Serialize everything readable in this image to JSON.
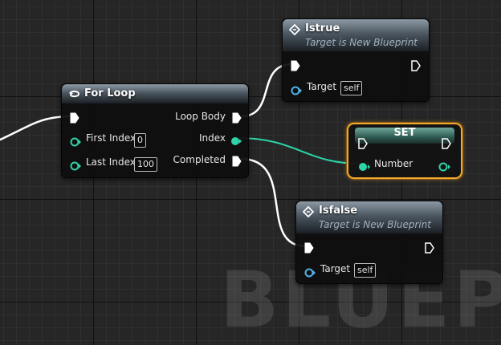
{
  "watermark": "BLUEPRI",
  "for_loop": {
    "title": "For Loop",
    "pins": {
      "loop_body": "Loop Body",
      "first_index": "First Index",
      "first_index_value": "0",
      "index": "Index",
      "last_index": "Last Index",
      "last_index_value": "100",
      "completed": "Completed"
    }
  },
  "istrue": {
    "title": "Istrue",
    "subtitle": "Target is New Blueprint",
    "target_label": "Target",
    "target_value": "self"
  },
  "isfalse": {
    "title": "Isfalse",
    "subtitle": "Target is New Blueprint",
    "target_label": "Target",
    "target_value": "self"
  },
  "set": {
    "title": "SET",
    "number_label": "Number"
  },
  "colors": {
    "exec": "#ffffff",
    "integer": "#2dd4a8",
    "object": "#4fb3e8",
    "selection": "#f0a830"
  },
  "icons": [
    "loop-icon",
    "function-icon",
    "exec-pin-icon",
    "data-pin-icon"
  ]
}
